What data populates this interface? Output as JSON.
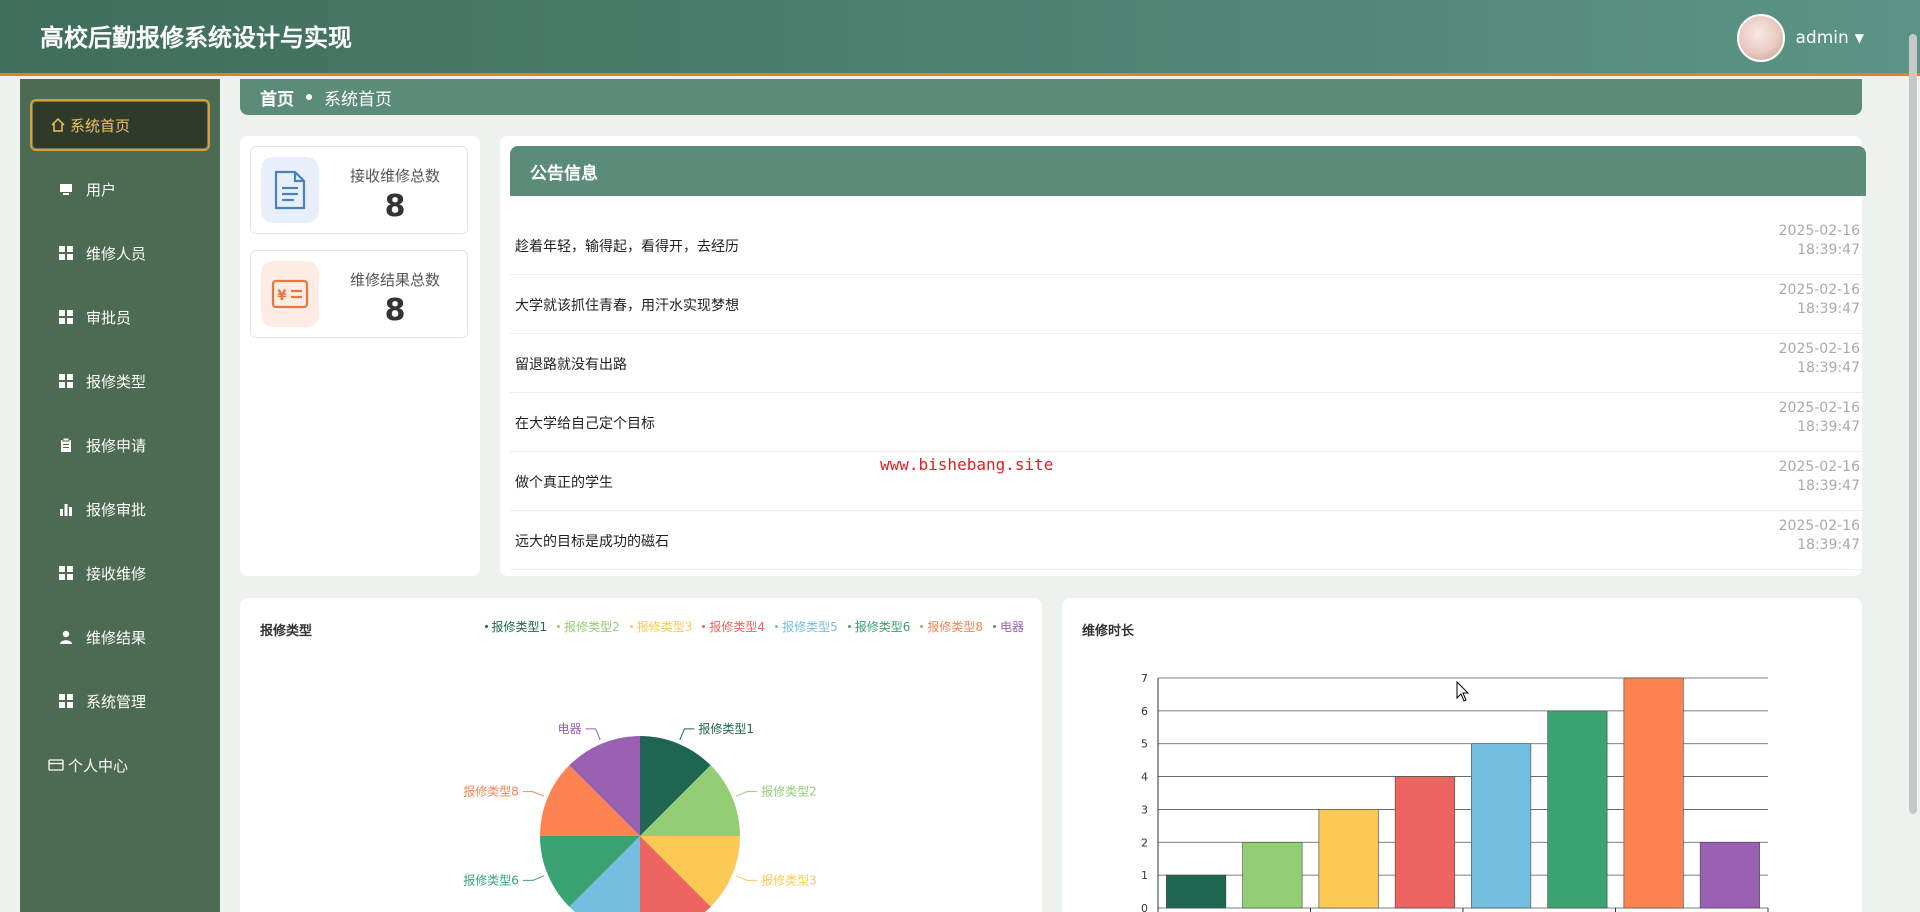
{
  "app": {
    "title": "高校后勤报修系统设计与实现",
    "username": "admin"
  },
  "sidebar": {
    "items": [
      {
        "label": "系统首页",
        "icon": "home-icon"
      },
      {
        "label": "用户",
        "icon": "monitor-icon"
      },
      {
        "label": "维修人员",
        "icon": "grid-icon"
      },
      {
        "label": "审批员",
        "icon": "grid-icon"
      },
      {
        "label": "报修类型",
        "icon": "grid-icon"
      },
      {
        "label": "报修申请",
        "icon": "clipboard-icon"
      },
      {
        "label": "报修审批",
        "icon": "bar-chart-icon"
      },
      {
        "label": "接收维修",
        "icon": "grid-icon"
      },
      {
        "label": "维修结果",
        "icon": "user-icon"
      },
      {
        "label": "系统管理",
        "icon": "grid-icon"
      },
      {
        "label": "个人中心",
        "icon": "card-icon"
      }
    ]
  },
  "breadcrumb": {
    "home": "首页",
    "current": "系统首页"
  },
  "stats": [
    {
      "label": "接收维修总数",
      "value": "8",
      "icon": "document-icon"
    },
    {
      "label": "维修结果总数",
      "value": "8",
      "icon": "yen-card-icon"
    }
  ],
  "notices": {
    "title": "公告信息",
    "items": [
      {
        "text": "趁着年轻，输得起，看得开，去经历",
        "date": "2025-02-16",
        "time": "18:39:47"
      },
      {
        "text": "大学就该抓住青春，用汗水实现梦想",
        "date": "2025-02-16",
        "time": "18:39:47"
      },
      {
        "text": "留退路就没有出路",
        "date": "2025-02-16",
        "time": "18:39:47"
      },
      {
        "text": "在大学给自己定个目标",
        "date": "2025-02-16",
        "time": "18:39:47"
      },
      {
        "text": "做个真正的学生",
        "date": "2025-02-16",
        "time": "18:39:47"
      },
      {
        "text": "远大的目标是成功的磁石",
        "date": "2025-02-16",
        "time": "18:39:47"
      }
    ]
  },
  "watermark": "www.bishebang.site",
  "colors": {
    "accent": "#5a8c79",
    "sidebar": "#4d6a52",
    "topbar_line": "#e67e22"
  },
  "chart_data": [
    {
      "type": "pie",
      "title": "报修类型",
      "legend_position": "top-right",
      "categories": [
        "报修类型1",
        "报修类型2",
        "报修类型3",
        "报修类型4",
        "报修类型5",
        "报修类型6",
        "报修类型8",
        "电器"
      ],
      "values": [
        1,
        1,
        1,
        1,
        1,
        1,
        1,
        1
      ],
      "colors": [
        "#1f6650",
        "#93cd74",
        "#fcc954",
        "#ec6561",
        "#73bedf",
        "#3ba272",
        "#fc8452",
        "#9a60b4"
      ],
      "visible_labels": [
        "报修类型1",
        "报修类型2",
        "报修类型3",
        "",
        "",
        "报修类型6",
        "报修类型8",
        "电器"
      ]
    },
    {
      "type": "bar",
      "title": "维修时长",
      "values": [
        1,
        2,
        3,
        4,
        5,
        6,
        7,
        2
      ],
      "colors": [
        "#1f6650",
        "#93cd74",
        "#fcc954",
        "#ec6561",
        "#73bedf",
        "#3ba272",
        "#fc8452",
        "#9a60b4"
      ],
      "ylim": [
        0,
        7
      ],
      "yticks": [
        "0",
        "1",
        "2",
        "3",
        "4",
        "5",
        "6",
        "7"
      ],
      "grid": true
    }
  ]
}
